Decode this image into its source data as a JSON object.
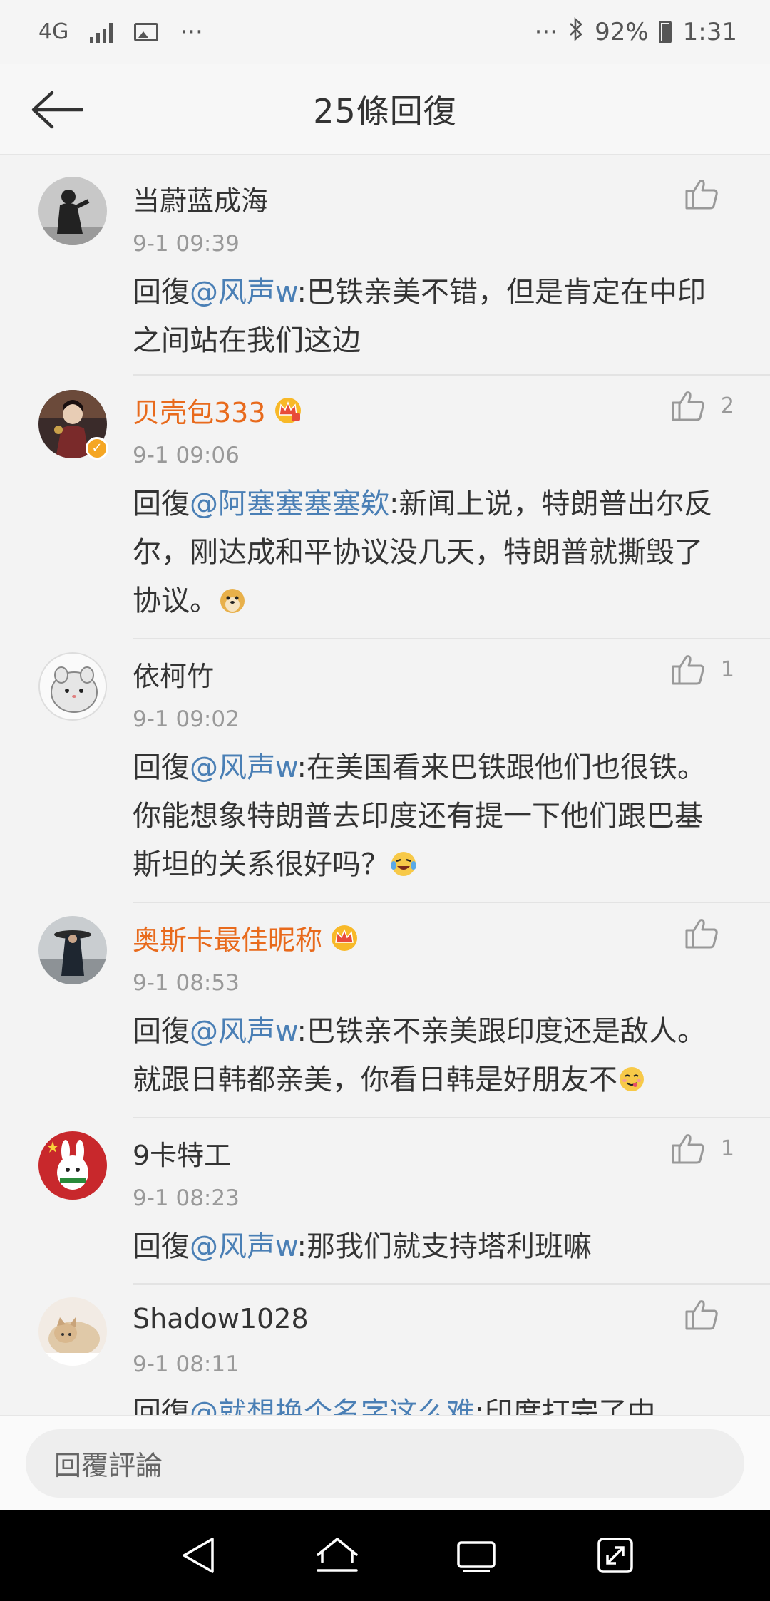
{
  "status_bar": {
    "network": "4G",
    "ellipsis_left": "···",
    "ellipsis_right": "···",
    "battery": "92%",
    "time": "1:31"
  },
  "header": {
    "title": "25條回復"
  },
  "reply_prefix": "回復",
  "comments": [
    {
      "name": "当蔚蓝成海",
      "time": "9-1 09:39",
      "mention": "@风声w",
      "text": ":巴铁亲美不错，但是肯定在中印之间站在我们这边",
      "likes": ""
    },
    {
      "name": "贝壳包333",
      "time": "9-1 09:06",
      "mention": "@阿塞塞塞塞欸",
      "text": ":新闻上说，特朗普出尔反尔，刚达成和平协议没几天，特朗普就撕毁了协议。",
      "likes": "2"
    },
    {
      "name": "依柯竹",
      "time": "9-1 09:02",
      "mention": "@风声w",
      "text": ":在美国看来巴铁跟他们也很铁。你能想象特朗普去印度还有提一下他们跟巴基斯坦的关系很好吗？",
      "likes": "1"
    },
    {
      "name": "奥斯卡最佳昵称",
      "time": "9-1 08:53",
      "mention": "@风声w",
      "text": ":巴铁亲不亲美跟印度还是敌人。就跟日韩都亲美，你看日韩是好朋友不",
      "likes": ""
    },
    {
      "name": "9卡特工",
      "time": "9-1 08:23",
      "mention": "@风声w",
      "text": ":那我们就支持塔利班嘛",
      "likes": "1"
    },
    {
      "name": "Shadow1028",
      "time": "9-1 08:11",
      "mention": "@就想换个名字这么难",
      "text": ":印度打完了中",
      "likes": ""
    }
  ],
  "reply_bar": {
    "placeholder": "回覆評論"
  },
  "colors": {
    "mention": "#4a7fb5",
    "vip_name": "#e86a1c",
    "background": "#f3f3f3"
  }
}
